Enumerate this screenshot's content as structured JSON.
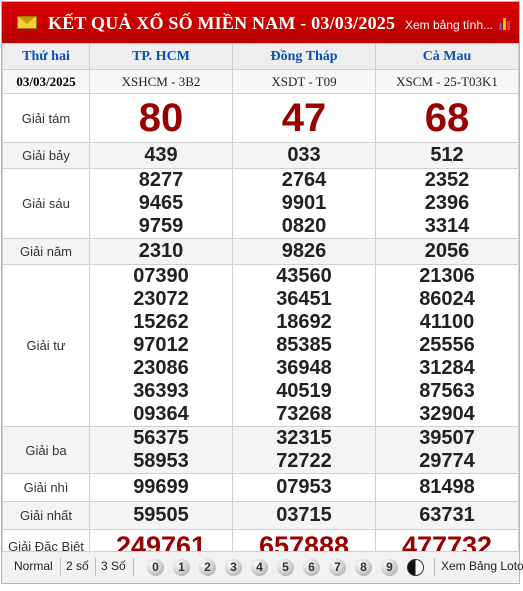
{
  "header": {
    "title": "KẾT QUẢ XỔ SỐ MIỀN NAM - 03/03/2025",
    "more_link": "Xem bảng tính..."
  },
  "columns": {
    "day": "Thứ hai",
    "date": "03/03/2025",
    "provinces": [
      {
        "name": "TP. HCM",
        "code": "XSHCM - 3B2"
      },
      {
        "name": "Đồng Tháp",
        "code": "XSDT - T09"
      },
      {
        "name": "Cà Mau",
        "code": "XSCM - 25-T03K1"
      }
    ]
  },
  "prizes": [
    {
      "label": "Giải tám",
      "values": [
        [
          "80"
        ],
        [
          "47"
        ],
        [
          "68"
        ]
      ]
    },
    {
      "label": "Giải bảy",
      "values": [
        [
          "439"
        ],
        [
          "033"
        ],
        [
          "512"
        ]
      ]
    },
    {
      "label": "Giải sáu",
      "values": [
        [
          "8277",
          "9465",
          "9759"
        ],
        [
          "2764",
          "9901",
          "0820"
        ],
        [
          "2352",
          "2396",
          "3314"
        ]
      ]
    },
    {
      "label": "Giải năm",
      "values": [
        [
          "2310"
        ],
        [
          "9826"
        ],
        [
          "2056"
        ]
      ]
    },
    {
      "label": "Giải tư",
      "values": [
        [
          "07390",
          "23072",
          "15262",
          "97012",
          "23086",
          "36393",
          "09364"
        ],
        [
          "43560",
          "36451",
          "18692",
          "85385",
          "36948",
          "40519",
          "73268"
        ],
        [
          "21306",
          "86024",
          "41100",
          "25556",
          "31284",
          "87563",
          "32904"
        ]
      ]
    },
    {
      "label": "Giải ba",
      "values": [
        [
          "56375",
          "58953"
        ],
        [
          "32315",
          "72722"
        ],
        [
          "39507",
          "29774"
        ]
      ]
    },
    {
      "label": "Giải nhì",
      "values": [
        [
          "99699"
        ],
        [
          "07953"
        ],
        [
          "81498"
        ]
      ]
    },
    {
      "label": "Giải nhất",
      "values": [
        [
          "59505"
        ],
        [
          "03715"
        ],
        [
          "63731"
        ]
      ]
    },
    {
      "label": "Giải Đặc Biệt",
      "values": [
        [
          "249761"
        ],
        [
          "657888"
        ],
        [
          "477732"
        ]
      ]
    }
  ],
  "footer": {
    "modes": [
      "Normal",
      "2 số",
      "3 Số"
    ],
    "digits": [
      "0",
      "1",
      "2",
      "3",
      "4",
      "5",
      "6",
      "7",
      "8",
      "9"
    ],
    "loto_link": "Xem Bảng Loto"
  },
  "colors": {
    "header_bg": "#c40000",
    "province_text": "#0b4fb3",
    "big_number": "#990000"
  },
  "icons": [
    "envelope-icon",
    "bar-chart-icon",
    "yin-yang-icon"
  ]
}
